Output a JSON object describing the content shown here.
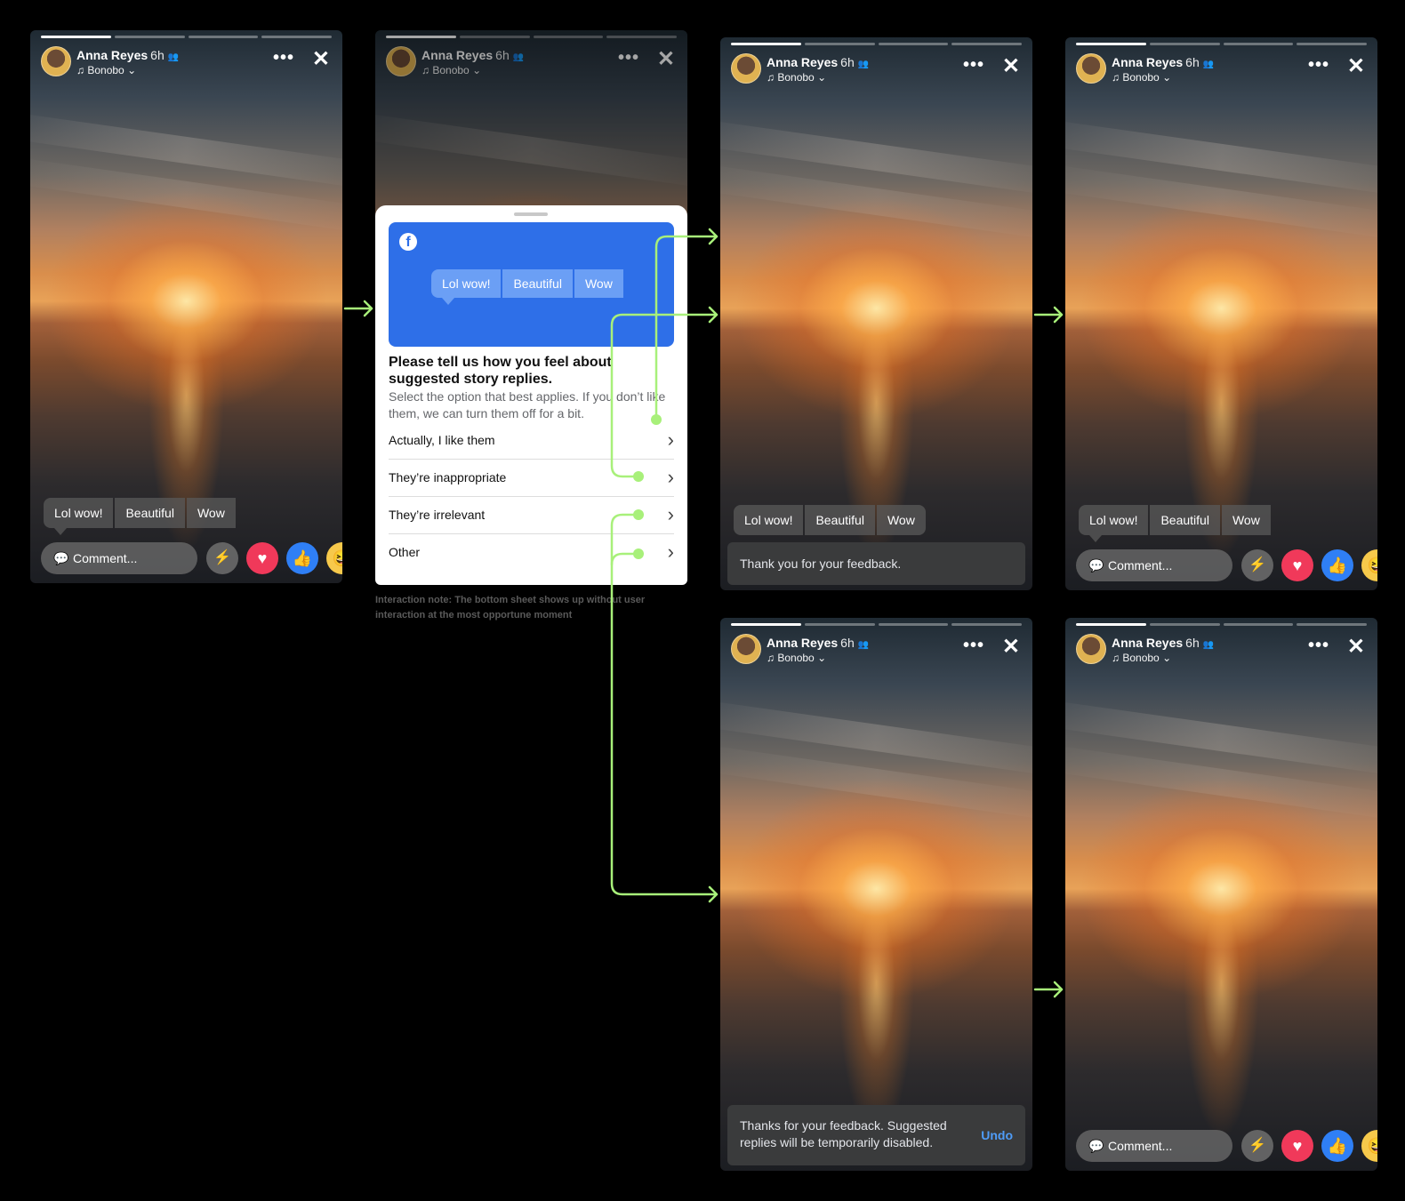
{
  "story": {
    "user_name": "Anna Reyes",
    "time": "6h",
    "friends_icon": "friends-icon",
    "song": "Bonobo",
    "more_icon": "more-dots-icon",
    "close_icon": "close-icon"
  },
  "suggested_replies": [
    "Lol wow!",
    "Beautiful",
    "Wow"
  ],
  "composer": {
    "placeholder": "Comment...",
    "reactions": [
      "messenger-icon",
      "love-reaction-icon",
      "like-reaction-icon",
      "haha-reaction-icon"
    ]
  },
  "sheet": {
    "banner_replies": [
      "Lol wow!",
      "Beautiful",
      "Wow"
    ],
    "title": "Please tell us how you feel about suggested story replies.",
    "subtitle": "Select the option that best applies. If you don’t like them, we can turn them off for a bit.",
    "options": [
      "Actually, I like them",
      "They’re inappropriate",
      "They’re irrelevant",
      "Other"
    ]
  },
  "toasts": {
    "thanks": "Thank you for your feedback.",
    "disabled": "Thanks for your feedback. Suggested replies will be temporarily disabled.",
    "undo": "Undo"
  },
  "interaction_note": "Interaction note: The bottom sheet shows up without user interaction at the most opportune moment",
  "colors": {
    "flow_arrow": "#a8f07a",
    "facebook_blue": "#2e6fe8",
    "love": "#f0395a",
    "like": "#2f7ff5"
  }
}
